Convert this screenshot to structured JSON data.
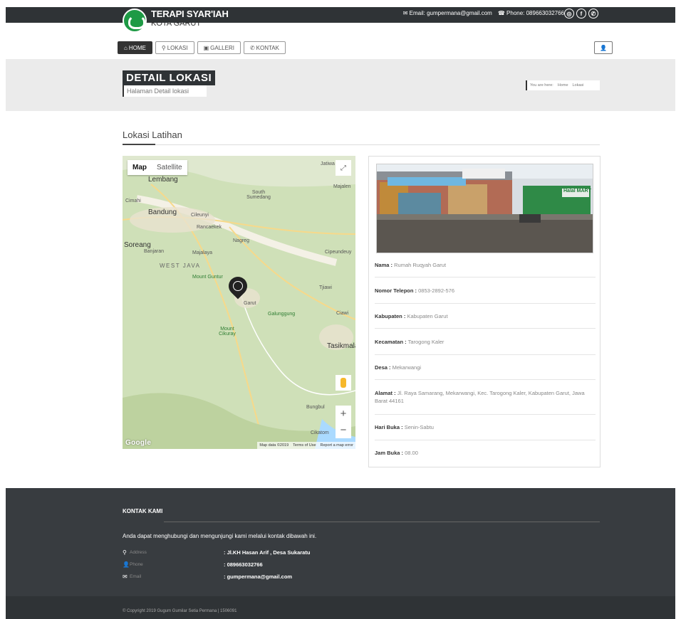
{
  "header": {
    "logo_title": "TERAPI SYAR'IAH",
    "logo_subtitle": "KOTA GARUT",
    "email_label": "Email: gumpermana@gmail.com",
    "phone_label": "Phone: 089663032766"
  },
  "nav": {
    "home": "HOME",
    "lokasi": "LOKASI",
    "galleri": "GALLERI",
    "kontak": "KONTAK"
  },
  "banner": {
    "title": "DETAIL LOKASI",
    "subtitle": "Halaman Detail lokasi",
    "breadcrumb_prefix": "You are here:",
    "breadcrumb_home": "Home",
    "breadcrumb_current": "Lokasi"
  },
  "section": {
    "title": "Lokasi Latihan"
  },
  "map": {
    "tab_map": "Map",
    "tab_satellite": "Satellite",
    "labels": {
      "lembang": "Lembang",
      "bandung": "Bandung",
      "cimahi": "Cimahi",
      "cileunyi": "Cileunyi",
      "rancaekek": "Rancaekek",
      "south_sumedang": "South Sumedang",
      "soreang": "Soreang",
      "banjaran": "Banjaran",
      "majalaya": "Majalaya",
      "nagreg": "Nagreg",
      "west_java": "WEST JAVA",
      "mount_guntur": "Mount Guntur",
      "garut": "Garut",
      "galunggung": "Galunggung",
      "mount_cikuray": "Mount Cikuray",
      "tasikmala": "Tasikmala",
      "cipeundeuy": "Cipeundeuy",
      "tjiawi": "Tjiawi",
      "jatiwangi": "Jatiwa",
      "majalengka": "Majalen",
      "bungbulang": "Bungbul",
      "cikatomas": "Cikatom",
      "ciawi": "Ciawi"
    },
    "google": "Google",
    "attribution_data": "Map data ©2019",
    "attribution_terms": "Terms of Use",
    "attribution_report": "Report a map error"
  },
  "detail": {
    "nama_label": "Nama :",
    "nama_value": "Rumah Ruqyah Garut",
    "telepon_label": "Nomor Telepon :",
    "telepon_value": "0853-2892-576",
    "kabupaten_label": "Kabupaten :",
    "kabupaten_value": "Kabupaten Garut",
    "kecamatan_label": "Kecamatan :",
    "kecamatan_value": "Tarogong Kaler",
    "desa_label": "Desa :",
    "desa_value": "Mekarwangi",
    "alamat_label": "Alamat :",
    "alamat_value": "Jl. Raya Samarang, Mekarwangi, Kec. Tarogong Kaler, Kabupaten Garut, Jawa Barat 44161",
    "hari_label": "Hari Buka :",
    "hari_value": "Senin-Sabtu",
    "jam_label": "Jam Buka :",
    "jam_value": "08.00",
    "photo_sign": "Halal MART"
  },
  "footer": {
    "title": "KONTAK KAMI",
    "description": "Anda dapat menghubungi dan mengunjungi kami melalui kontak dibawah ini.",
    "address_label": "Address",
    "address_value": ": Jl.KH Hasan Arif , Desa Sukaratu",
    "phone_label": "Phone",
    "phone_value": ": 089663032766",
    "email_label": "Email",
    "email_value": ": gumpermana@gmail.com",
    "copyright": "© Copyright 2019 Gugum Gumilar Setia Permana | 1506091"
  },
  "colors": {
    "dark_bar": "#2f3336",
    "footer": "#383c40",
    "logo_green": "#1e9a45",
    "map_green": "#c9dbb1"
  }
}
